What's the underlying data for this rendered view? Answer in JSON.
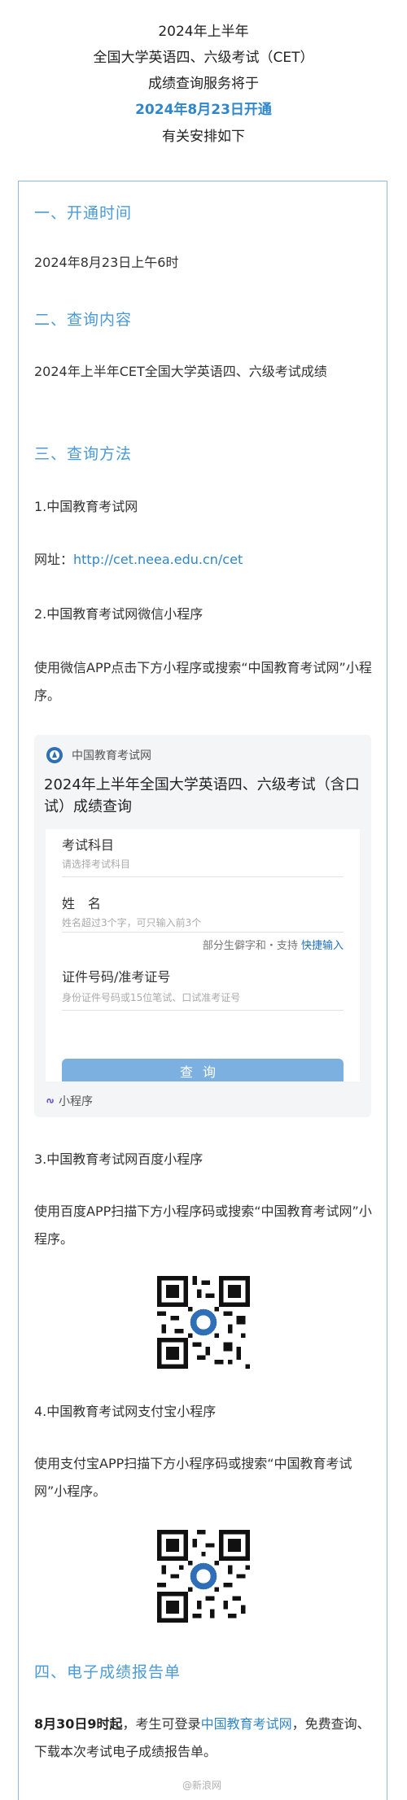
{
  "header": {
    "line1": "2024年上半年",
    "line2": "全国大学英语四、六级考试（CET）",
    "line3": "成绩查询服务将于",
    "line4": "2024年8月23日开通",
    "line5": "有关安排如下"
  },
  "colors": {
    "accent": "#4b9ad8",
    "highlight": "#2f86c9",
    "border": "#8fb9dd"
  },
  "sections": {
    "s1": {
      "title": "一、开通时间",
      "body": "2024年8月23日上午6时"
    },
    "s2": {
      "title": "二、查询内容",
      "body": "2024年上半年CET全国大学英语四、六级考试成绩"
    },
    "s3": {
      "title": "三、查询方法",
      "m1": "1.中国教育考试网",
      "m1_url_label": "网址：",
      "m1_url": "http://cet.neea.edu.cn/cet",
      "m2": "2.中国教育考试网微信小程序",
      "m2_desc": "使用微信APP点击下方小程序或搜索“中国教育考试网”小程序。",
      "m3": "3.中国教育考试网百度小程序",
      "m3_desc": "使用百度APP扫描下方小程序码或搜索“中国教育考试网”小程序。",
      "m4": "4.中国教育考试网支付宝小程序",
      "m4_desc": "使用支付宝APP扫描下方小程序码或搜索“中国教育考试网”小程序。"
    },
    "s4": {
      "title": "四、电子成绩报告单",
      "body_bold": "8月30日9时起",
      "body_mid": "，考生可登录",
      "body_link": "中国教育考试网",
      "body_end": "，免费查询、下载本次考试电子成绩报告单。"
    }
  },
  "mini_program": {
    "org": "中国教育考试网",
    "title": "2024年上半年全国大学英语四、六级考试（含口试）成绩查询",
    "subject_label": "考试科目",
    "subject_placeholder": "请选择考试科目",
    "name_label": "姓　名",
    "name_placeholder": "姓名超过3个字，可只输入前3个",
    "hint": "部分生僻字和・支持",
    "hint_link": "快捷输入",
    "id_label": "证件号码/准考证号",
    "id_placeholder": "身份证件号码或15位笔试、口试准考证号",
    "button": "查询",
    "footer": "小程序",
    "logo_icon": "neea-logo-icon",
    "footer_icon": "mini-program-icon"
  },
  "watermark": "@新浪网"
}
